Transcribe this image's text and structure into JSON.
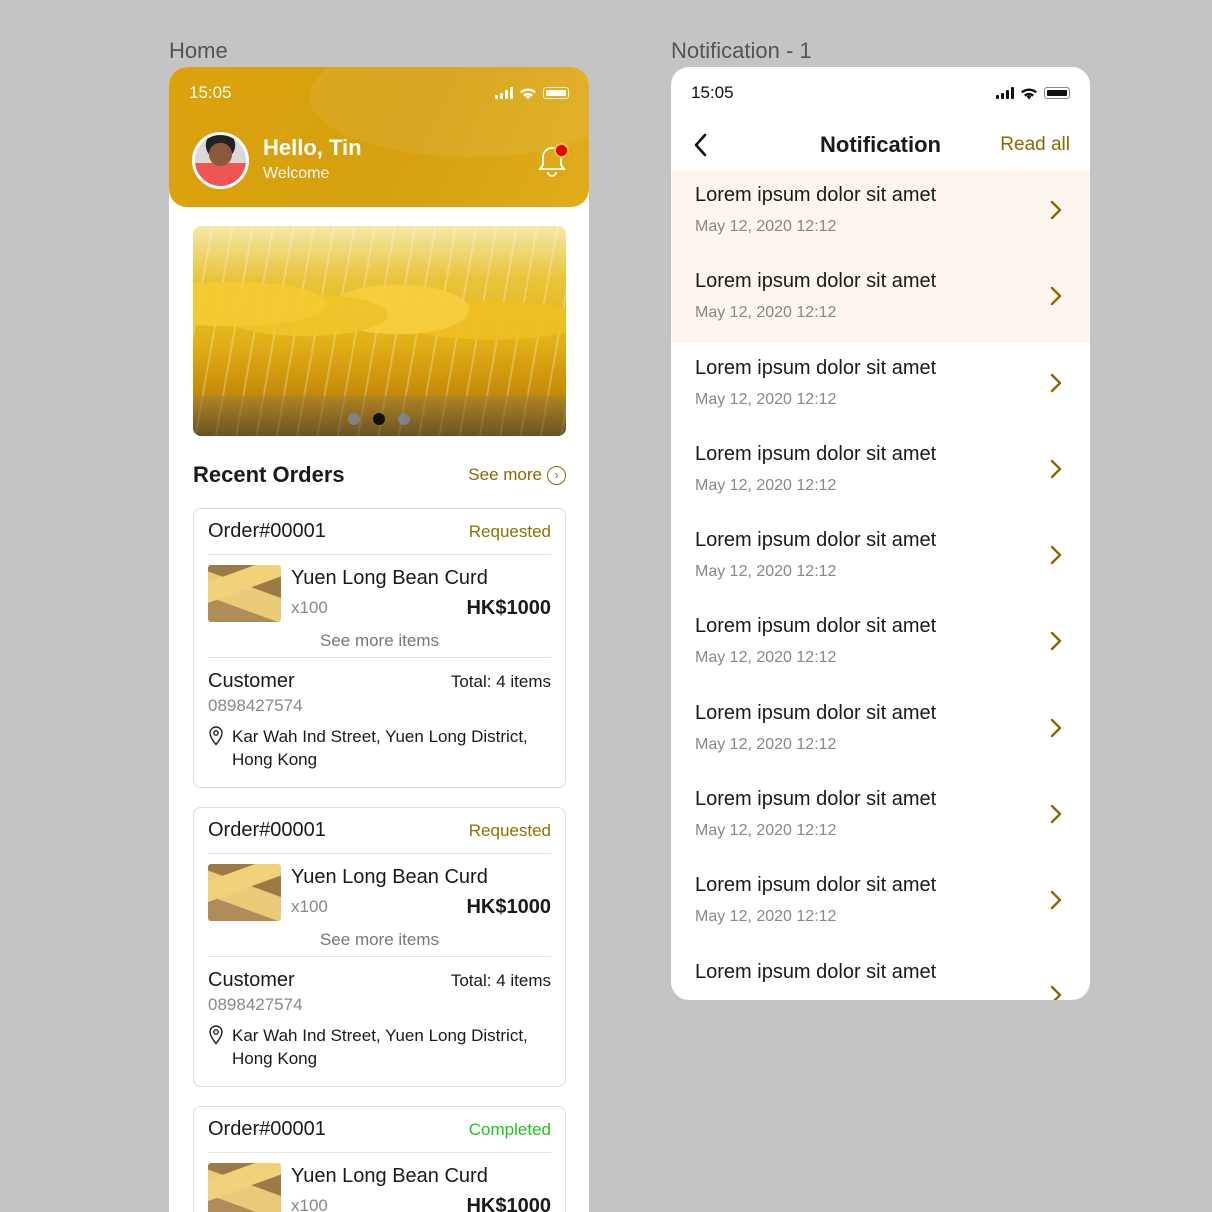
{
  "frames": {
    "home_label": "Home",
    "notif_label": "Notification - 1"
  },
  "home": {
    "time": "15:05",
    "greeting": "Hello, Tin",
    "welcome": "Welcome",
    "section_title": "Recent Orders",
    "see_more": "See more",
    "orders": [
      {
        "id": "Order#00001",
        "status": "Requested",
        "item_name": "Yuen Long Bean Curd",
        "qty": "x100",
        "price": "HK$1000",
        "more_items": "See more items",
        "customer_label": "Customer",
        "total": "Total:  4 items",
        "phone": "0898427574",
        "address": "Kar Wah Ind Street, Yuen Long District, Hong Kong"
      },
      {
        "id": "Order#00001",
        "status": "Requested",
        "item_name": "Yuen Long Bean Curd",
        "qty": "x100",
        "price": "HK$1000",
        "more_items": "See more items",
        "customer_label": "Customer",
        "total": "Total:  4 items",
        "phone": "0898427574",
        "address": "Kar Wah Ind Street, Yuen Long District, Hong Kong"
      },
      {
        "id": "Order#00001",
        "status": "Completed",
        "item_name": "Yuen Long Bean Curd",
        "qty": "x100",
        "price": "HK$1000"
      }
    ]
  },
  "notification": {
    "time": "15:05",
    "title": "Notification",
    "read_all": "Read all",
    "items": [
      {
        "title": "Lorem ipsum dolor sit amet",
        "date": "May 12, 2020 12:12"
      },
      {
        "title": "Lorem ipsum dolor sit amet",
        "date": "May 12, 2020 12:12"
      },
      {
        "title": "Lorem ipsum dolor sit amet",
        "date": "May 12, 2020 12:12"
      },
      {
        "title": "Lorem ipsum dolor sit amet",
        "date": "May 12, 2020 12:12"
      },
      {
        "title": "Lorem ipsum dolor sit amet",
        "date": "May 12, 2020 12:12"
      },
      {
        "title": "Lorem ipsum dolor sit amet",
        "date": "May 12, 2020 12:12"
      },
      {
        "title": "Lorem ipsum dolor sit amet",
        "date": "May 12, 2020 12:12"
      },
      {
        "title": "Lorem ipsum dolor sit amet",
        "date": "May 12, 2020 12:12"
      },
      {
        "title": "Lorem ipsum dolor sit amet",
        "date": "May 12, 2020 12:12"
      },
      {
        "title": "Lorem ipsum dolor sit amet",
        "date": ""
      }
    ]
  },
  "colors": {
    "accent": "#d9a30d",
    "gold_text": "#8a6a00",
    "completed": "#22c41a",
    "unread_bg": "#fdf6ee"
  },
  "icons": {
    "back": "chevron-left-icon",
    "arrow": "chevron-right-icon",
    "bell": "bell-icon",
    "pin": "location-pin-icon"
  }
}
